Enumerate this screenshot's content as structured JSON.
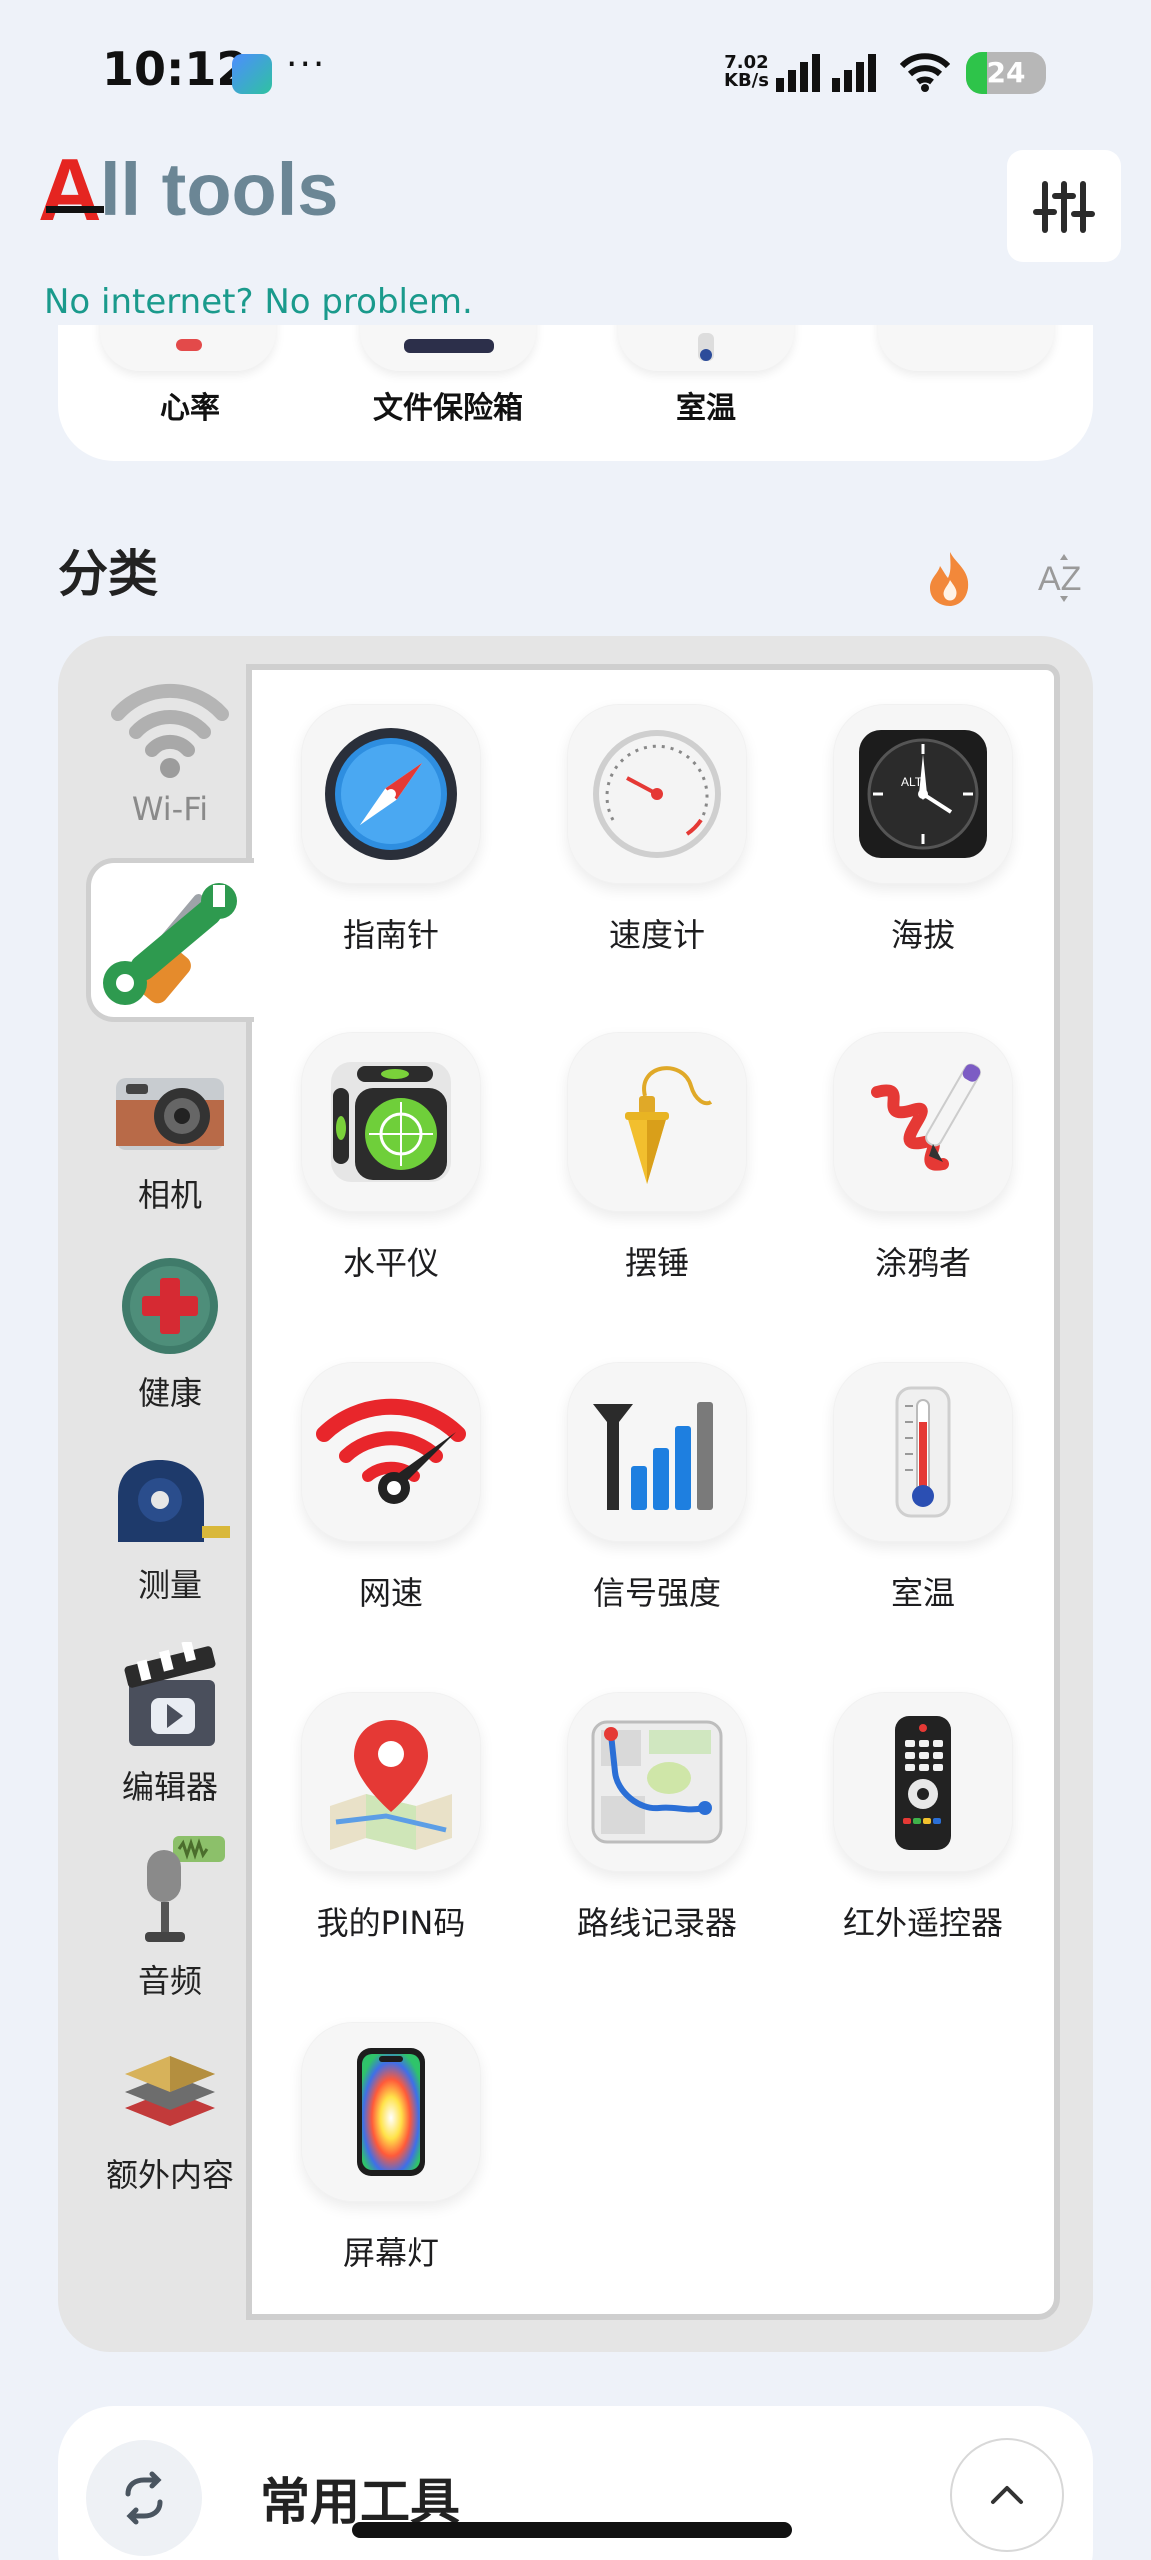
{
  "status_bar": {
    "time": "10:12",
    "more": "···",
    "net_speed_value": "7.02",
    "net_speed_unit": "KB/s",
    "battery": "24"
  },
  "header": {
    "logo_a": "A",
    "logo_rest": "ll tools",
    "subtitle": "No internet? No problem.",
    "settings_icon": "sliders-icon"
  },
  "favorites": {
    "items": [
      {
        "label": "心率"
      },
      {
        "label": "文件保险箱"
      },
      {
        "label": "室温"
      },
      {
        "label": ""
      }
    ]
  },
  "categories": {
    "title": "分类",
    "sort_popular_icon": "fire-icon",
    "sort_alpha_label": "AZ",
    "sidebar": [
      {
        "label": "Wi-Fi",
        "icon": "wifi-icon"
      },
      {
        "label": "",
        "icon": "wrench-screwdriver-icon",
        "active": true
      },
      {
        "label": "相机",
        "icon": "camera-icon"
      },
      {
        "label": "健康",
        "icon": "health-cross-icon"
      },
      {
        "label": "测量",
        "icon": "tape-measure-icon"
      },
      {
        "label": "编辑器",
        "icon": "clapperboard-icon"
      },
      {
        "label": "音频",
        "icon": "microphone-icon"
      },
      {
        "label": "额外内容",
        "icon": "layers-icon"
      }
    ],
    "tools": [
      {
        "label": "指南针",
        "icon": "compass-icon"
      },
      {
        "label": "速度计",
        "icon": "speedometer-icon"
      },
      {
        "label": "海拔",
        "icon": "altimeter-icon"
      },
      {
        "label": "水平仪",
        "icon": "level-icon"
      },
      {
        "label": "摆锤",
        "icon": "plumb-bob-icon"
      },
      {
        "label": "涂鸦者",
        "icon": "scribble-icon"
      },
      {
        "label": "网速",
        "icon": "network-speed-icon"
      },
      {
        "label": "信号强度",
        "icon": "signal-strength-icon"
      },
      {
        "label": "室温",
        "icon": "thermometer-icon"
      },
      {
        "label": "我的PIN码",
        "icon": "map-pin-icon"
      },
      {
        "label": "路线记录器",
        "icon": "route-map-icon"
      },
      {
        "label": "红外遥控器",
        "icon": "remote-control-icon"
      },
      {
        "label": "屏幕灯",
        "icon": "screen-light-icon"
      }
    ]
  },
  "common_tools": {
    "title": "常用工具",
    "refresh_icon": "refresh-icon",
    "collapse_icon": "chevron-up-icon"
  },
  "colors": {
    "accent_red": "#e52521",
    "logo_gray": "#6b8695",
    "subtitle_teal": "#1a9a8c",
    "background": "#eef2f9"
  }
}
